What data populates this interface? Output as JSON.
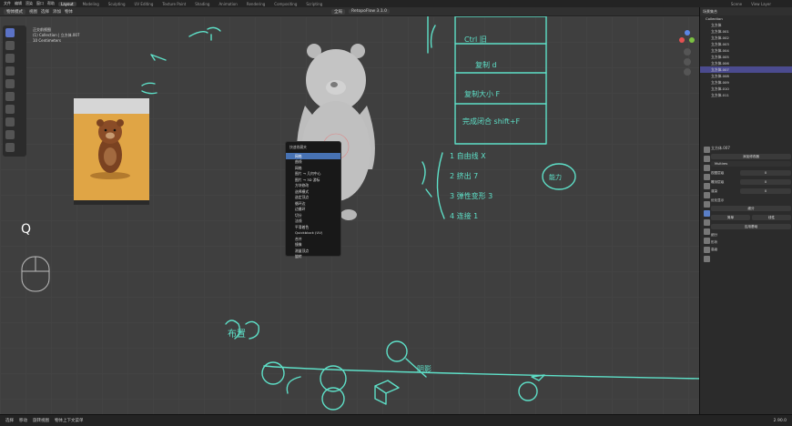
{
  "topbar": {
    "menus": [
      "文件",
      "编辑",
      "渲染",
      "窗口",
      "帮助"
    ],
    "workspaces": [
      "Layout",
      "Modeling",
      "Sculpting",
      "UV Editing",
      "Texture Paint",
      "Shading",
      "Animation",
      "Rendering",
      "Compositing",
      "Scripting"
    ],
    "scene_label": "Scene",
    "view_layer_label": "View Layer"
  },
  "header": {
    "mode": "物体模式",
    "menus": [
      "视图",
      "选择",
      "添加",
      "物体"
    ],
    "transform": "全局",
    "addon": "RetopoFlow 3.1.0"
  },
  "viewport": {
    "view_name": "正交前视图",
    "collection_line": "(1) Collection | 立方体.007",
    "units": "10 Centimeters",
    "key_overlay": "Q"
  },
  "context_menu": {
    "title": "快速收藏夹",
    "items": [
      "网格",
      "曲线",
      "网格",
      "图片 → 几何中心",
      "图片 → 3D 游标",
      "方块修改",
      "选择模式",
      "选定顶点",
      "循环边",
      "边循环",
      "切分",
      "法线",
      "平滑着色",
      "Quickblock (UV)",
      "合并",
      "镜像",
      "测量顶点",
      "旋转",
      "缩放"
    ],
    "highlighted_index": 0
  },
  "handwriting": {
    "note_lines": [
      "Ctrl 旧",
      "复制 d",
      "复制大小 F",
      "完成闭合 shift+F",
      "1 自由线 X",
      "2 挤出 7",
      "3 弹性变形 3",
      "4 连接 1",
      "能力",
      "布置",
      "阴影"
    ]
  },
  "outliner": {
    "header": "场景集合",
    "collection": "Collection",
    "objects": [
      "立方体",
      "立方体.001",
      "立方体.002",
      "立方体.003",
      "立方体.004",
      "立方体.005",
      "立方体.006",
      "立方体.007",
      "立方体.008",
      "立方体.009",
      "立方体.010",
      "立方体.011"
    ],
    "selected_index": 7
  },
  "properties": {
    "object_name": "立方体.007",
    "add_modifier": "添加修改器",
    "modifier_name": "Multires",
    "fields": [
      {
        "label": "视图层级",
        "value": "0"
      },
      {
        "label": "雕刻层级",
        "value": "0"
      },
      {
        "label": "渲染",
        "value": "0"
      }
    ],
    "subdivide_buttons": [
      "细分",
      "简单",
      "线性"
    ],
    "panels": [
      "细分",
      "形状",
      "高级"
    ],
    "apply_label": "应用基础",
    "checkbox_label": "优化显示"
  },
  "statusbar": {
    "items": [
      "选择",
      "移动",
      "旋转视图",
      "物体上下文菜单"
    ],
    "version": "2.90.0"
  },
  "colors": {
    "accent": "#4772b3",
    "handwriting": "#5ee0c8",
    "viewport_bg": "#3f3f3f"
  }
}
